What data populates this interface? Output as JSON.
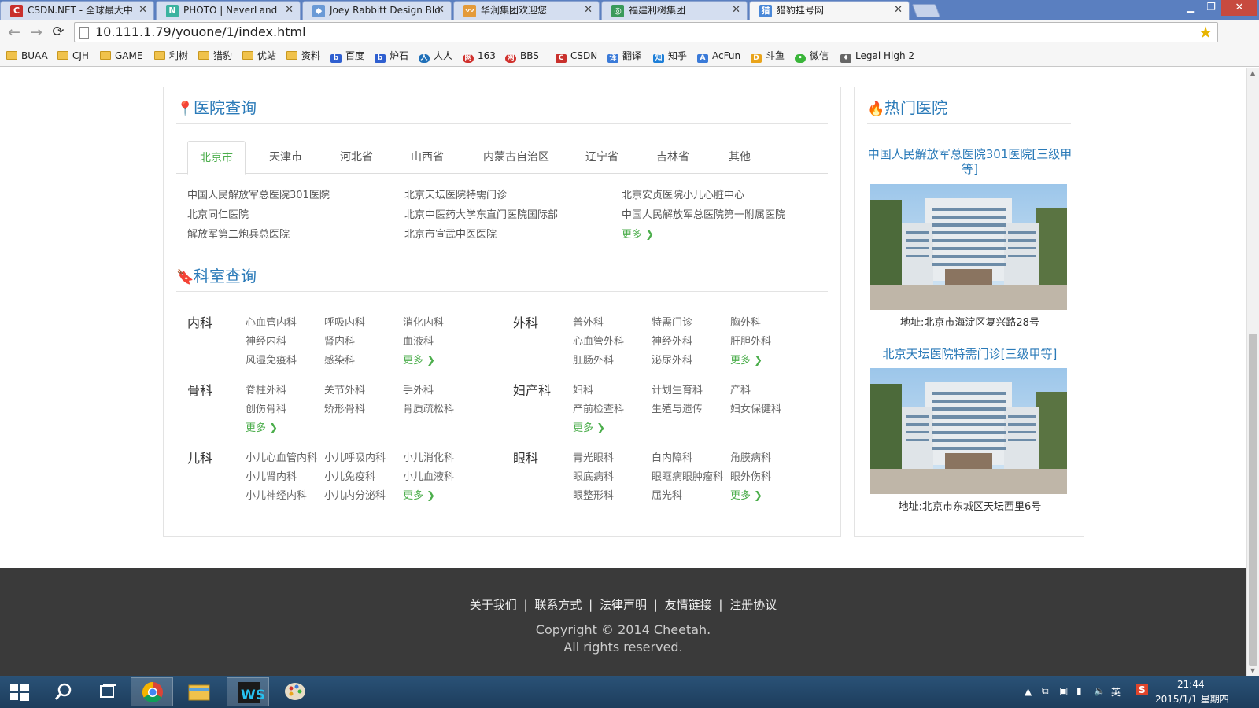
{
  "browser": {
    "tabs": [
      {
        "title": "CSDN.NET - 全球最大中",
        "icon": "C",
        "color": "#c9302c"
      },
      {
        "title": "PHOTO | NeverLand",
        "icon": "N",
        "color": "#3bb3a0"
      },
      {
        "title": "Joey Rabbitt Design Blo",
        "icon": "◆",
        "color": "#6a9ad6"
      },
      {
        "title": "华润集团欢迎您",
        "icon": "〰",
        "color": "#e49b3a"
      },
      {
        "title": "福建利树集团",
        "icon": "◎",
        "color": "#3a9a5a"
      },
      {
        "title": "猎豹挂号网",
        "icon": "猎",
        "color": "#4a88d8"
      }
    ],
    "url": "10.111.1.79/youone/1/index.html",
    "bookmarks": [
      {
        "label": "BUAA",
        "type": "folder"
      },
      {
        "label": "CJH",
        "type": "folder"
      },
      {
        "label": "GAME",
        "type": "folder"
      },
      {
        "label": "利树",
        "type": "folder"
      },
      {
        "label": "猎豹",
        "type": "folder"
      },
      {
        "label": "优站",
        "type": "folder"
      },
      {
        "label": "资料",
        "type": "folder"
      },
      {
        "label": "百度",
        "type": "site",
        "color": "#2f5fd0"
      },
      {
        "label": "炉石",
        "type": "site",
        "color": "#2f5fd0"
      },
      {
        "label": "人人",
        "type": "site",
        "color": "#1f6fb8"
      },
      {
        "label": "163",
        "type": "site",
        "color": "#d0312d"
      },
      {
        "label": "BBS",
        "type": "site",
        "color": "#d0312d"
      },
      {
        "label": "CSDN",
        "type": "site",
        "color": "#c9302c"
      },
      {
        "label": "翻译",
        "type": "site",
        "color": "#3a7ad8"
      },
      {
        "label": "知乎",
        "type": "site",
        "color": "#1e7fd8"
      },
      {
        "label": "AcFun",
        "type": "site",
        "color": "#3a7ad8"
      },
      {
        "label": "斗鱼",
        "type": "site",
        "color": "#e9a41b"
      },
      {
        "label": "微信",
        "type": "site",
        "color": "#3ab53a"
      },
      {
        "label": "Legal High 2",
        "type": "site",
        "color": "#666666"
      }
    ]
  },
  "hospital_search": {
    "title": "医院查询",
    "tabs": [
      "北京市",
      "天津市",
      "河北省",
      "山西省",
      "内蒙古自治区",
      "辽宁省",
      "吉林省",
      "其他"
    ],
    "columns": [
      [
        "中国人民解放军总医院301医院",
        "北京同仁医院",
        "解放军第二炮兵总医院"
      ],
      [
        "北京天坛医院特需门诊",
        "北京中医药大学东直门医院国际部",
        "北京市宣武中医医院"
      ],
      [
        "北京安贞医院小儿心脏中心",
        "中国人民解放军总医院第一附属医院"
      ]
    ],
    "more": "更多"
  },
  "dept_search": {
    "title": "科室查询",
    "categories": [
      {
        "name": "内科",
        "items": [
          "心血管内科",
          "呼吸内科",
          "消化内科",
          "神经内科",
          "肾内科",
          "血液科",
          "风湿免疫科",
          "感染科"
        ]
      },
      {
        "name": "外科",
        "items": [
          "普外科",
          "特需门诊",
          "胸外科",
          "心血管外科",
          "神经外科",
          "肝胆外科",
          "肛肠外科",
          "泌尿外科"
        ]
      },
      {
        "name": "骨科",
        "items": [
          "脊柱外科",
          "关节外科",
          "手外科",
          "创伤骨科",
          "矫形骨科",
          "骨质疏松科"
        ]
      },
      {
        "name": "妇产科",
        "items": [
          "妇科",
          "计划生育科",
          "产科",
          "产前检查科",
          "生殖与遗传",
          "妇女保健科"
        ]
      },
      {
        "name": "儿科",
        "items": [
          "小儿心血管内科",
          "小儿呼吸内科",
          "小儿消化科",
          "小儿肾内科",
          "小儿免疫科",
          "小儿血液科",
          "小儿神经内科",
          "小儿内分泌科"
        ]
      },
      {
        "name": "眼科",
        "items": [
          "青光眼科",
          "白内障科",
          "角膜病科",
          "眼底病科",
          "眼眶病眼肿瘤科",
          "眼外伤科",
          "眼整形科",
          "屈光科"
        ]
      }
    ],
    "more": "更多"
  },
  "hot_hospitals": {
    "title": "热门医院",
    "items": [
      {
        "name": "中国人民解放军总医院301医院[三级甲等]",
        "address": "地址:北京市海淀区复兴路28号"
      },
      {
        "name": "北京天坛医院特需门诊[三级甲等]",
        "address": "地址:北京市东城区天坛西里6号"
      }
    ]
  },
  "footer": {
    "links": [
      "关于我们",
      "联系方式",
      "法律声明",
      "友情链接",
      "注册协议"
    ],
    "separator": "|",
    "copyright_line1": "Copyright © 2014 Cheetah.",
    "copyright_line2": "All rights reserved."
  },
  "taskbar": {
    "time": "21:44",
    "date": "2015/1/1 星期四",
    "ime": "英"
  },
  "colors": {
    "accent": "#2a7ab8",
    "more": "#4cae4c",
    "footer_bg": "#3a3a3a"
  }
}
